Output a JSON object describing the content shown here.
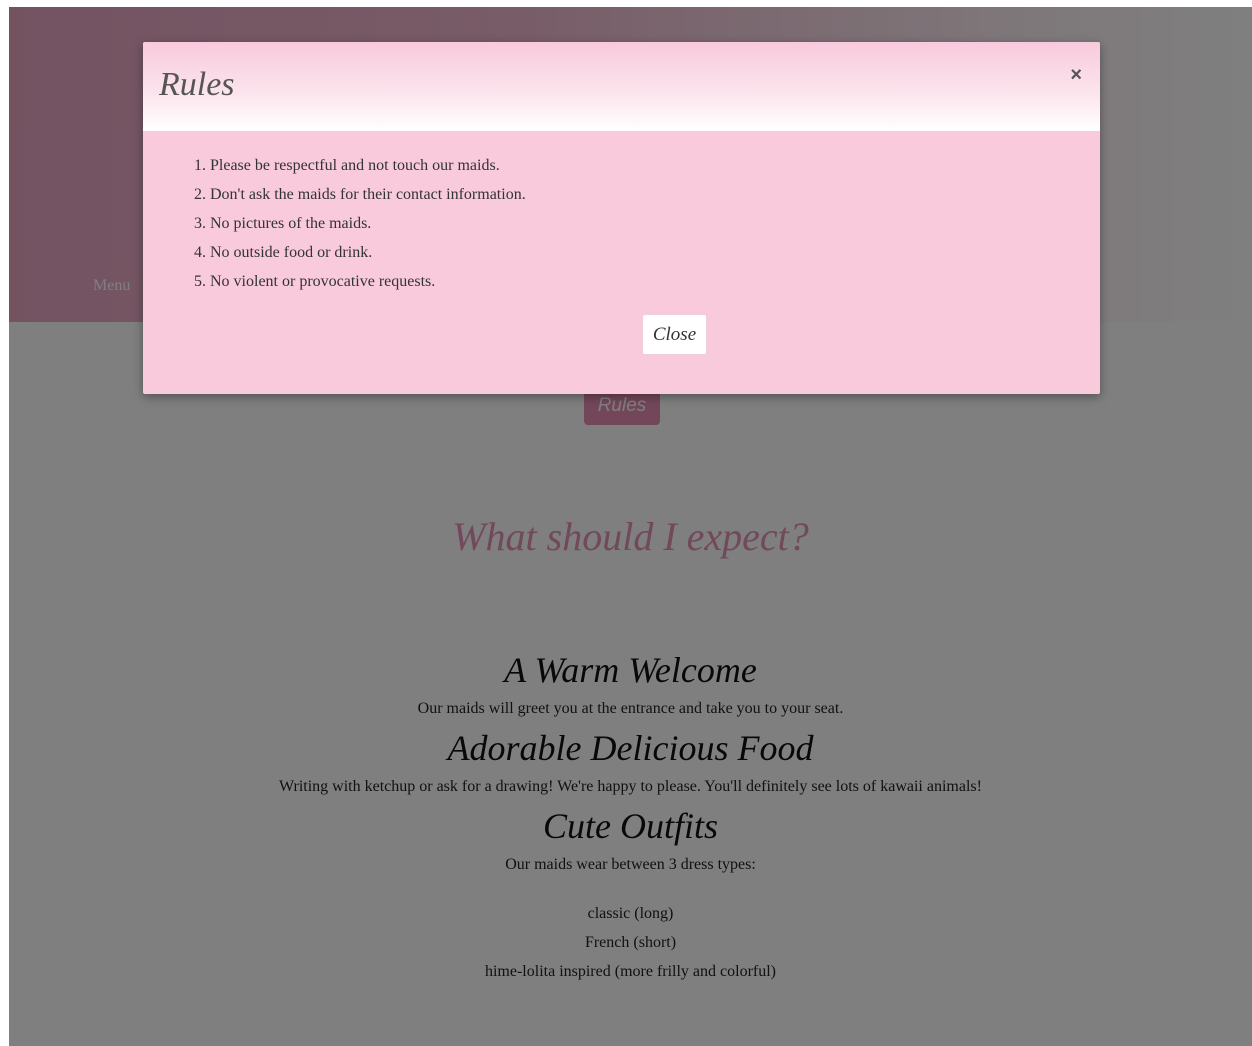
{
  "nav": {
    "menu_label": "Menu"
  },
  "rules_button": {
    "label": "Rules"
  },
  "expect": {
    "title": "What should I expect?"
  },
  "features": [
    {
      "title": "A Warm Welcome",
      "text": "Our maids will greet you at the entrance and take you to your seat."
    },
    {
      "title": "Adorable Delicious  Food",
      "text": "Writing with ketchup or ask for a drawing! We're happy to please. You'll definitely see lots of kawaii animals!"
    },
    {
      "title": "Cute Outfits",
      "text": "Our maids wear between 3 dress types:"
    }
  ],
  "dress_types": [
    "classic (long)",
    "French (short)",
    "hime-lolita inspired (more frilly and colorful)"
  ],
  "modal": {
    "title": "Rules",
    "close_x": "×",
    "rules": [
      "Please be respectful and not touch our maids.",
      "Don't ask the maids for their contact information.",
      "No pictures of the maids.",
      "No outside food or drink.",
      "No violent or provocative requests."
    ],
    "close_label": "Close"
  },
  "colors": {
    "brand_pink": "#e68fb3",
    "modal_bg": "#f8cadc",
    "heading_pink": "#e392b6"
  }
}
